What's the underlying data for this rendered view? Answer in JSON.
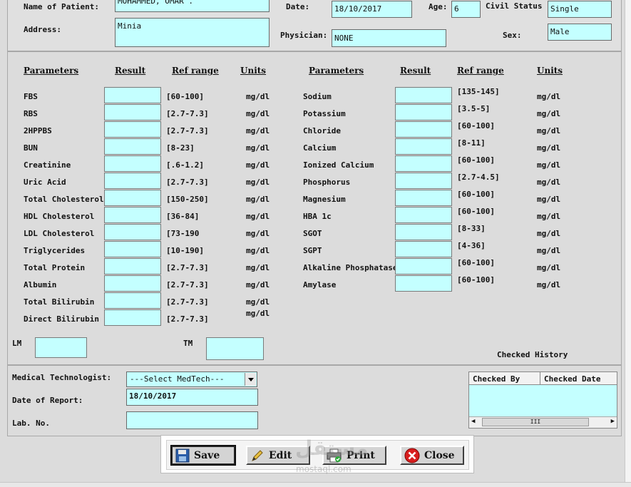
{
  "header": {
    "patient_label": "Name of Patient:",
    "patient_value": "MOHAMMED, OMAR  .",
    "date_label": "Date:",
    "date_value": "18/10/2017",
    "age_label": "Age:",
    "age_value": "6",
    "civil_label": "Civil Status",
    "civil_value": "Single",
    "address_label": "Address:",
    "address_value": "Minia",
    "physician_label": "Physician:",
    "physician_value": "NONE",
    "sex_label": "Sex:",
    "sex_value": "Male"
  },
  "columns": {
    "parameters": "Parameters",
    "result": "Result",
    "ref_range": "Ref range",
    "units": "Units"
  },
  "left_tests": [
    {
      "name": "FBS",
      "ref": "[60-100]",
      "unit": "mg/dl"
    },
    {
      "name": "RBS",
      "ref": "[2.7-7.3]",
      "unit": "mg/dl"
    },
    {
      "name": "2HPPBS",
      "ref": "[2.7-7.3]",
      "unit": "mg/dl"
    },
    {
      "name": "BUN",
      "ref": "[8-23]",
      "unit": "mg/dl"
    },
    {
      "name": "Creatinine",
      "ref": "[.6-1.2]",
      "unit": "mg/dl"
    },
    {
      "name": "Uric Acid",
      "ref": "[2.7-7.3]",
      "unit": "mg/dl"
    },
    {
      "name": "Total Cholesterol",
      "ref": "[150-250]",
      "unit": "mg/dl"
    },
    {
      "name": "HDL Cholesterol",
      "ref": "[36-84]",
      "unit": "mg/dl"
    },
    {
      "name": "LDL Cholesterol",
      "ref": "[73-190",
      "unit": "mg/dl"
    },
    {
      "name": "Triglycerides",
      "ref": "[10-190]",
      "unit": "mg/dl"
    },
    {
      "name": "Total Protein",
      "ref": "[2.7-7.3]",
      "unit": "mg/dl"
    },
    {
      "name": "Albumin",
      "ref": "[2.7-7.3]",
      "unit": "mg/dl"
    },
    {
      "name": "Total Bilirubin",
      "ref": "[2.7-7.3]",
      "unit": "mg/dl"
    },
    {
      "name": "Direct Bilirubin",
      "ref": "[2.7-7.3]",
      "unit": "mg/dl"
    }
  ],
  "right_tests": [
    {
      "name": "Sodium",
      "ref": "[135-145]",
      "unit": "mg/dl"
    },
    {
      "name": "Potassium",
      "ref": "[3.5-5]",
      "unit": "mg/dl"
    },
    {
      "name": "Chloride",
      "ref": "[60-100]",
      "unit": "mg/dl"
    },
    {
      "name": "Calcium",
      "ref": "[8-11]",
      "unit": "mg/dl"
    },
    {
      "name": "Ionized Calcium",
      "ref": "[60-100]",
      "unit": "mg/dl"
    },
    {
      "name": "Phosphorus",
      "ref": "[2.7-4.5]",
      "unit": "mg/dl"
    },
    {
      "name": "Magnesium",
      "ref": "[60-100]",
      "unit": "mg/dl"
    },
    {
      "name": "HBA 1c",
      "ref": "[60-100]",
      "unit": "mg/dl"
    },
    {
      "name": "SGOT",
      "ref": "[8-33]",
      "unit": "mg/dl"
    },
    {
      "name": "SGPT",
      "ref": "[4-36]",
      "unit": "mg/dl"
    },
    {
      "name": "Alkaline Phosphatase",
      "ref": "[60-100]",
      "unit": "mg/dl"
    },
    {
      "name": "Amylase",
      "ref": "[60-100]",
      "unit": "mg/dl"
    }
  ],
  "extra": {
    "lm_label": "LM",
    "tm_label": "TM",
    "checked_history_label": "Checked History",
    "checked_by_header": "Checked By",
    "checked_date_header": "Checked Date",
    "scroll_thumb": "III"
  },
  "bottom": {
    "medtech_label": "Medical Technologist:",
    "medtech_selected": "---Select MedTech---",
    "report_date_label": "Date of Report:",
    "report_date_value": "18/10/2017",
    "lab_no_label": "Lab. No.",
    "lab_no_value": ""
  },
  "buttons": {
    "save": "Save",
    "edit": "Edit",
    "print": "Print",
    "close": "Close"
  },
  "watermark": {
    "arabic": "مستقل",
    "latin": "mostaql.com"
  }
}
